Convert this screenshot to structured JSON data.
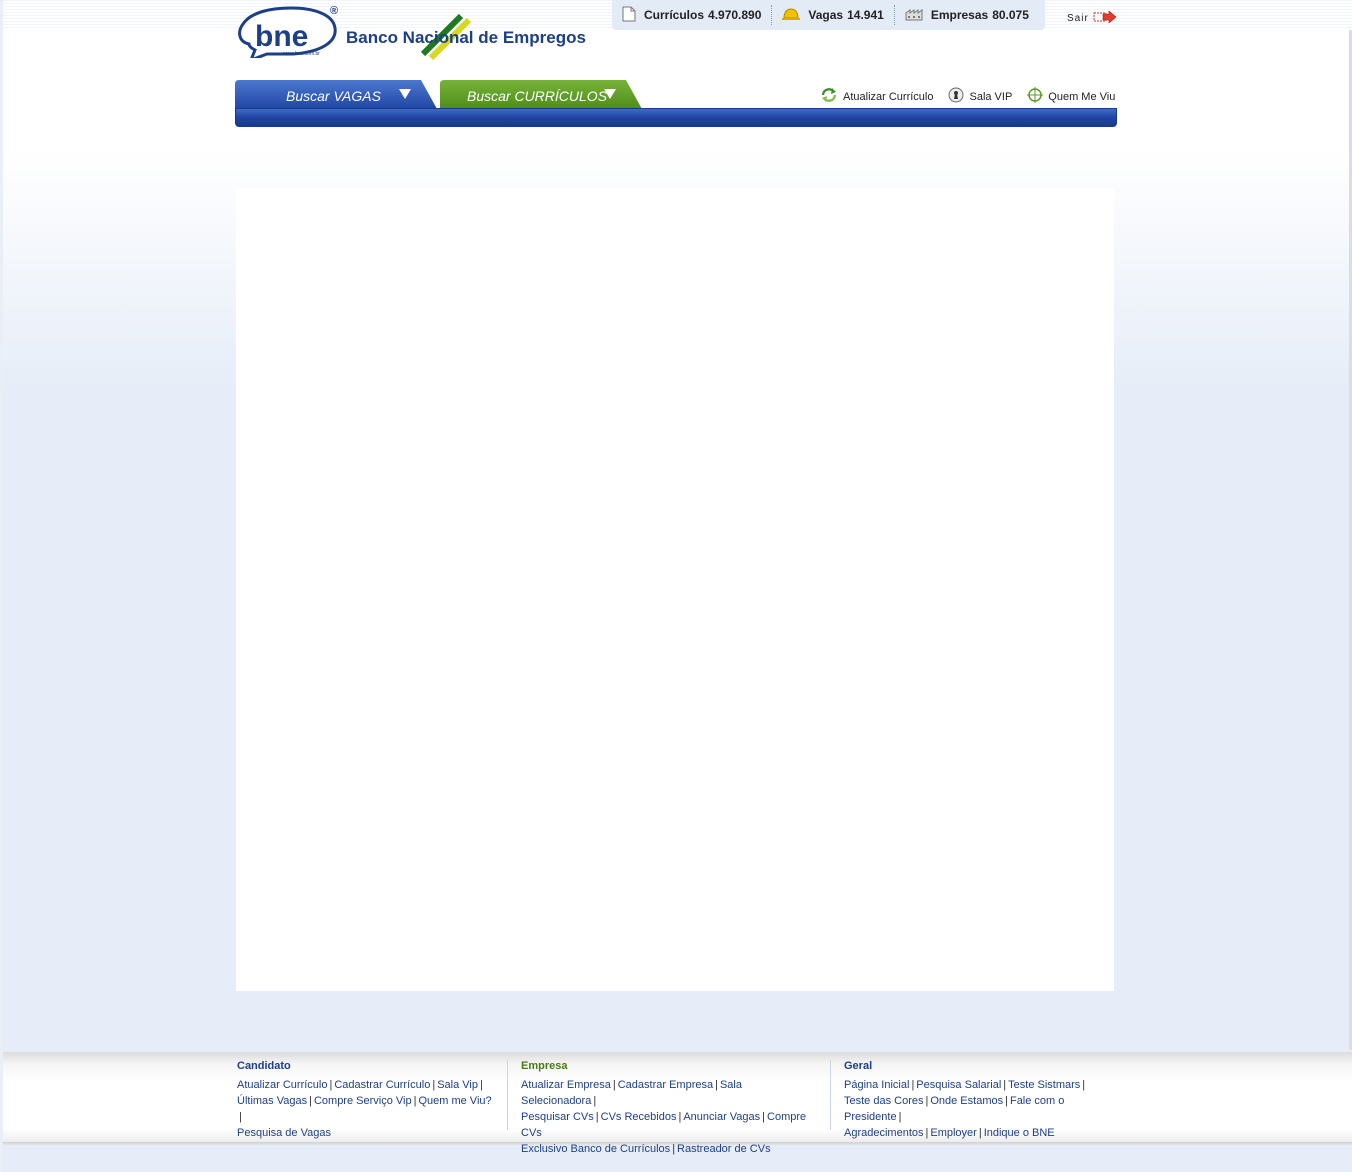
{
  "brand": {
    "logo_mark": "bne",
    "logo_url_small": "www.bne.com.br",
    "name": "Banco Nacional de Empregos",
    "registered": "®"
  },
  "stats": [
    {
      "icon": "document-icon",
      "label": "Currículos",
      "value": "4.970.890"
    },
    {
      "icon": "hard-hat-icon",
      "label": "Vagas",
      "value": "14.941"
    },
    {
      "icon": "building-icon",
      "label": "Empresas",
      "value": "80.075"
    }
  ],
  "header": {
    "logout_label": "Sair"
  },
  "nav": {
    "tabs": [
      {
        "label": "Buscar VAGAS",
        "color": "#1f46a4"
      },
      {
        "label": "Buscar CURRÍCULOS",
        "color": "#4e8c1a"
      }
    ],
    "quick_links": [
      {
        "icon": "refresh-icon",
        "label": "Atualizar Currículo"
      },
      {
        "icon": "keyhole-icon",
        "label": "Sala VIP"
      },
      {
        "icon": "crosshair-icon",
        "label": "Quem Me Viu"
      }
    ]
  },
  "footer": {
    "candidato": {
      "title": "Candidato",
      "links": [
        "Atualizar Currículo",
        "Cadastrar Currículo",
        "Sala Vip",
        "Últimas Vagas",
        "Compre Serviço Vip",
        "Quem me Viu?",
        "Pesquisa de Vagas"
      ]
    },
    "empresa": {
      "title": "Empresa",
      "links": [
        "Atualizar Empresa",
        "Cadastrar Empresa",
        "Sala Selecionadora",
        "Pesquisar CVs",
        "CVs Recebidos",
        "Anunciar Vagas",
        "Compre CVs",
        "Exclusivo Banco de Currículos",
        "Rastreador de CVs"
      ]
    },
    "geral": {
      "title": "Geral",
      "links": [
        "Página Inicial",
        "Pesquisa Salarial",
        "Teste Sistmars",
        "Teste das Cores",
        "Onde Estamos",
        "Fale com o Presidente",
        "Agradecimentos",
        "Employer",
        "Indique o BNE"
      ]
    }
  },
  "colors": {
    "brand_blue": "#1c3f88",
    "nav_blue": "#1f46a4",
    "nav_green": "#4e8c1a",
    "page_bg": "#e6edf8"
  }
}
